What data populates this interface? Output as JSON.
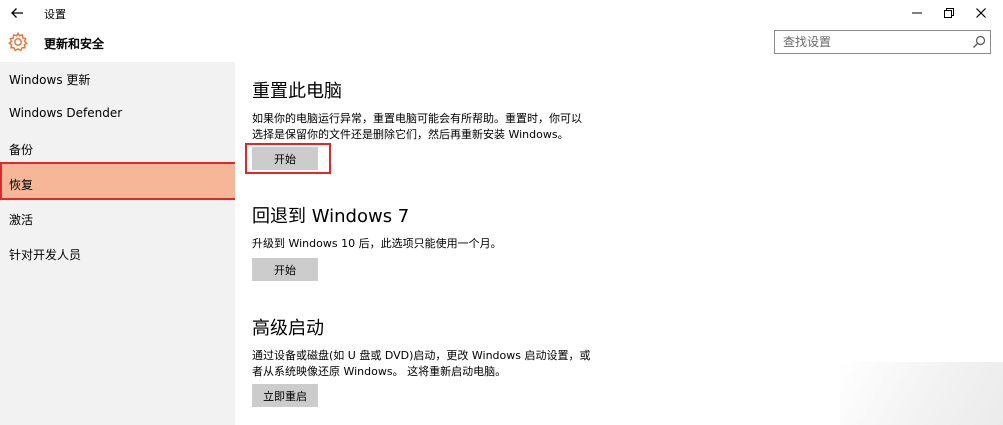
{
  "window": {
    "title": "设置",
    "controls": {
      "minimize": "–",
      "maximize": "❐",
      "close": "✕"
    }
  },
  "header": {
    "title": "更新和安全",
    "icon": "gear-icon"
  },
  "search": {
    "placeholder": "查找设置",
    "value": "",
    "icon": "search-icon"
  },
  "sidebar": {
    "items": [
      {
        "label": "Windows 更新"
      },
      {
        "label": "Windows Defender"
      },
      {
        "label": "备份"
      },
      {
        "label": "恢复"
      },
      {
        "label": "激活"
      },
      {
        "label": "针对开发人员"
      }
    ],
    "selected_index": 3
  },
  "main": {
    "sections": [
      {
        "title": "重置此电脑",
        "description": "如果你的电脑运行异常，重置电脑可能会有所帮助。重置时，你可以选择是保留你的文件还是删除它们，然后再重新安装 Windows。",
        "button_label": "开始"
      },
      {
        "title": "回退到 Windows 7",
        "description": "升级到 Windows 10 后，此选项只能使用一个月。",
        "button_label": "开始"
      },
      {
        "title": "高级启动",
        "description": "通过设备或磁盘(如 U 盘或 DVD)启动，更改 Windows 启动设置，或者从系统映像还原 Windows。 这将重新启动电脑。",
        "button_label": "立即重启"
      }
    ]
  },
  "colors": {
    "accent": "#f5b797",
    "highlight_border": "#e0282a",
    "gear_icon": "#e8763a",
    "sidebar_bg": "#f2f2f2",
    "button_bg": "#cccccc"
  }
}
